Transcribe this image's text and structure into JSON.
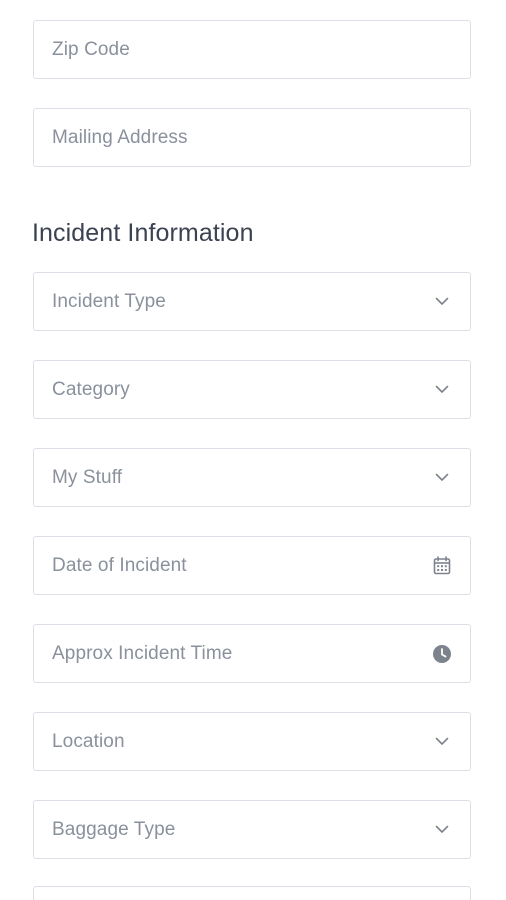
{
  "fields_top": [
    {
      "placeholder": "Zip Code"
    },
    {
      "placeholder": "Mailing Address"
    }
  ],
  "incident_section": {
    "title": "Incident Information",
    "fields": [
      {
        "placeholder": "Incident Type",
        "icon": "chevron-down-icon"
      },
      {
        "placeholder": "Category",
        "icon": "chevron-down-icon"
      },
      {
        "placeholder": "My Stuff",
        "icon": "chevron-down-icon"
      },
      {
        "placeholder": "Date of Incident",
        "icon": "calendar-icon"
      },
      {
        "placeholder": "Approx Incident Time",
        "icon": "clock-icon"
      },
      {
        "placeholder": "Location",
        "icon": "chevron-down-icon"
      },
      {
        "placeholder": "Baggage Type",
        "icon": "chevron-down-icon"
      }
    ]
  },
  "colors": {
    "border": "#dcdfe5",
    "placeholder": "#8a919c",
    "heading": "#3b4251",
    "icon": "#7d838d"
  }
}
